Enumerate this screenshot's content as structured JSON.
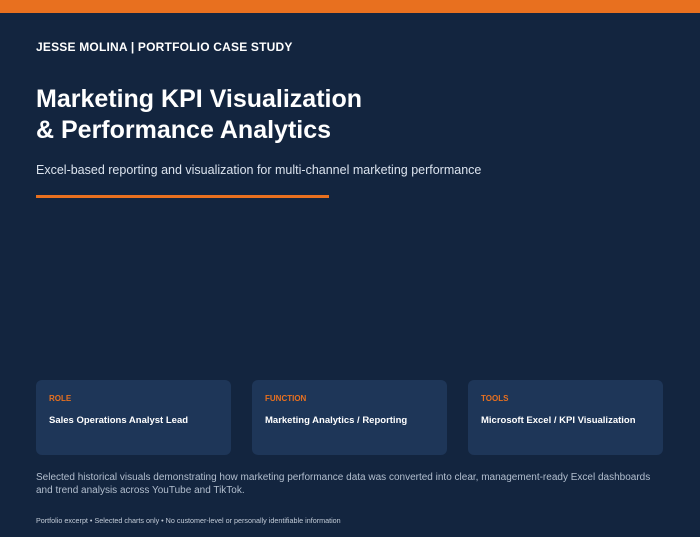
{
  "header": {
    "kicker": "JESSE MOLINA | PORTFOLIO CASE STUDY",
    "title_line1": "Marketing KPI Visualization",
    "title_line2": "& Performance Analytics",
    "subtitle": "Excel-based reporting and visualization for multi-channel marketing performance"
  },
  "cards": {
    "role": {
      "label": "ROLE",
      "value": "Sales Operations Analyst Lead"
    },
    "function": {
      "label": "FUNCTION",
      "value": "Marketing Analytics / Reporting"
    },
    "tools": {
      "label": "TOOLS",
      "value": "Microsoft Excel / KPI Visualization"
    }
  },
  "description": "Selected historical visuals demonstrating how marketing performance data was converted into clear, management-ready Excel dashboards and trend analysis across YouTube and TikTok.",
  "footnote": "Portfolio excerpt • Selected charts only • No customer-level or personally identifiable information",
  "colors": {
    "background": "#13253f",
    "accent": "#e8701f",
    "card": "#1e3658"
  }
}
